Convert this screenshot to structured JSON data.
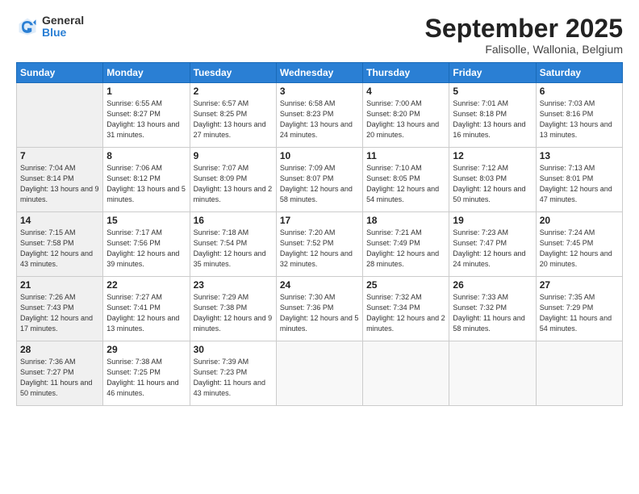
{
  "logo": {
    "general": "General",
    "blue": "Blue"
  },
  "title": "September 2025",
  "location": "Falisolle, Wallonia, Belgium",
  "days_of_week": [
    "Sunday",
    "Monday",
    "Tuesday",
    "Wednesday",
    "Thursday",
    "Friday",
    "Saturday"
  ],
  "weeks": [
    [
      {
        "day": "",
        "info": ""
      },
      {
        "day": "1",
        "info": "Sunrise: 6:55 AM\nSunset: 8:27 PM\nDaylight: 13 hours\nand 31 minutes."
      },
      {
        "day": "2",
        "info": "Sunrise: 6:57 AM\nSunset: 8:25 PM\nDaylight: 13 hours\nand 27 minutes."
      },
      {
        "day": "3",
        "info": "Sunrise: 6:58 AM\nSunset: 8:23 PM\nDaylight: 13 hours\nand 24 minutes."
      },
      {
        "day": "4",
        "info": "Sunrise: 7:00 AM\nSunset: 8:20 PM\nDaylight: 13 hours\nand 20 minutes."
      },
      {
        "day": "5",
        "info": "Sunrise: 7:01 AM\nSunset: 8:18 PM\nDaylight: 13 hours\nand 16 minutes."
      },
      {
        "day": "6",
        "info": "Sunrise: 7:03 AM\nSunset: 8:16 PM\nDaylight: 13 hours\nand 13 minutes."
      }
    ],
    [
      {
        "day": "7",
        "info": "Sunrise: 7:04 AM\nSunset: 8:14 PM\nDaylight: 13 hours\nand 9 minutes."
      },
      {
        "day": "8",
        "info": "Sunrise: 7:06 AM\nSunset: 8:12 PM\nDaylight: 13 hours\nand 5 minutes."
      },
      {
        "day": "9",
        "info": "Sunrise: 7:07 AM\nSunset: 8:09 PM\nDaylight: 13 hours\nand 2 minutes."
      },
      {
        "day": "10",
        "info": "Sunrise: 7:09 AM\nSunset: 8:07 PM\nDaylight: 12 hours\nand 58 minutes."
      },
      {
        "day": "11",
        "info": "Sunrise: 7:10 AM\nSunset: 8:05 PM\nDaylight: 12 hours\nand 54 minutes."
      },
      {
        "day": "12",
        "info": "Sunrise: 7:12 AM\nSunset: 8:03 PM\nDaylight: 12 hours\nand 50 minutes."
      },
      {
        "day": "13",
        "info": "Sunrise: 7:13 AM\nSunset: 8:01 PM\nDaylight: 12 hours\nand 47 minutes."
      }
    ],
    [
      {
        "day": "14",
        "info": "Sunrise: 7:15 AM\nSunset: 7:58 PM\nDaylight: 12 hours\nand 43 minutes."
      },
      {
        "day": "15",
        "info": "Sunrise: 7:17 AM\nSunset: 7:56 PM\nDaylight: 12 hours\nand 39 minutes."
      },
      {
        "day": "16",
        "info": "Sunrise: 7:18 AM\nSunset: 7:54 PM\nDaylight: 12 hours\nand 35 minutes."
      },
      {
        "day": "17",
        "info": "Sunrise: 7:20 AM\nSunset: 7:52 PM\nDaylight: 12 hours\nand 32 minutes."
      },
      {
        "day": "18",
        "info": "Sunrise: 7:21 AM\nSunset: 7:49 PM\nDaylight: 12 hours\nand 28 minutes."
      },
      {
        "day": "19",
        "info": "Sunrise: 7:23 AM\nSunset: 7:47 PM\nDaylight: 12 hours\nand 24 minutes."
      },
      {
        "day": "20",
        "info": "Sunrise: 7:24 AM\nSunset: 7:45 PM\nDaylight: 12 hours\nand 20 minutes."
      }
    ],
    [
      {
        "day": "21",
        "info": "Sunrise: 7:26 AM\nSunset: 7:43 PM\nDaylight: 12 hours\nand 17 minutes."
      },
      {
        "day": "22",
        "info": "Sunrise: 7:27 AM\nSunset: 7:41 PM\nDaylight: 12 hours\nand 13 minutes."
      },
      {
        "day": "23",
        "info": "Sunrise: 7:29 AM\nSunset: 7:38 PM\nDaylight: 12 hours\nand 9 minutes."
      },
      {
        "day": "24",
        "info": "Sunrise: 7:30 AM\nSunset: 7:36 PM\nDaylight: 12 hours\nand 5 minutes."
      },
      {
        "day": "25",
        "info": "Sunrise: 7:32 AM\nSunset: 7:34 PM\nDaylight: 12 hours\nand 2 minutes."
      },
      {
        "day": "26",
        "info": "Sunrise: 7:33 AM\nSunset: 7:32 PM\nDaylight: 11 hours\nand 58 minutes."
      },
      {
        "day": "27",
        "info": "Sunrise: 7:35 AM\nSunset: 7:29 PM\nDaylight: 11 hours\nand 54 minutes."
      }
    ],
    [
      {
        "day": "28",
        "info": "Sunrise: 7:36 AM\nSunset: 7:27 PM\nDaylight: 11 hours\nand 50 minutes."
      },
      {
        "day": "29",
        "info": "Sunrise: 7:38 AM\nSunset: 7:25 PM\nDaylight: 11 hours\nand 46 minutes."
      },
      {
        "day": "30",
        "info": "Sunrise: 7:39 AM\nSunset: 7:23 PM\nDaylight: 11 hours\nand 43 minutes."
      },
      {
        "day": "",
        "info": ""
      },
      {
        "day": "",
        "info": ""
      },
      {
        "day": "",
        "info": ""
      },
      {
        "day": "",
        "info": ""
      }
    ]
  ]
}
